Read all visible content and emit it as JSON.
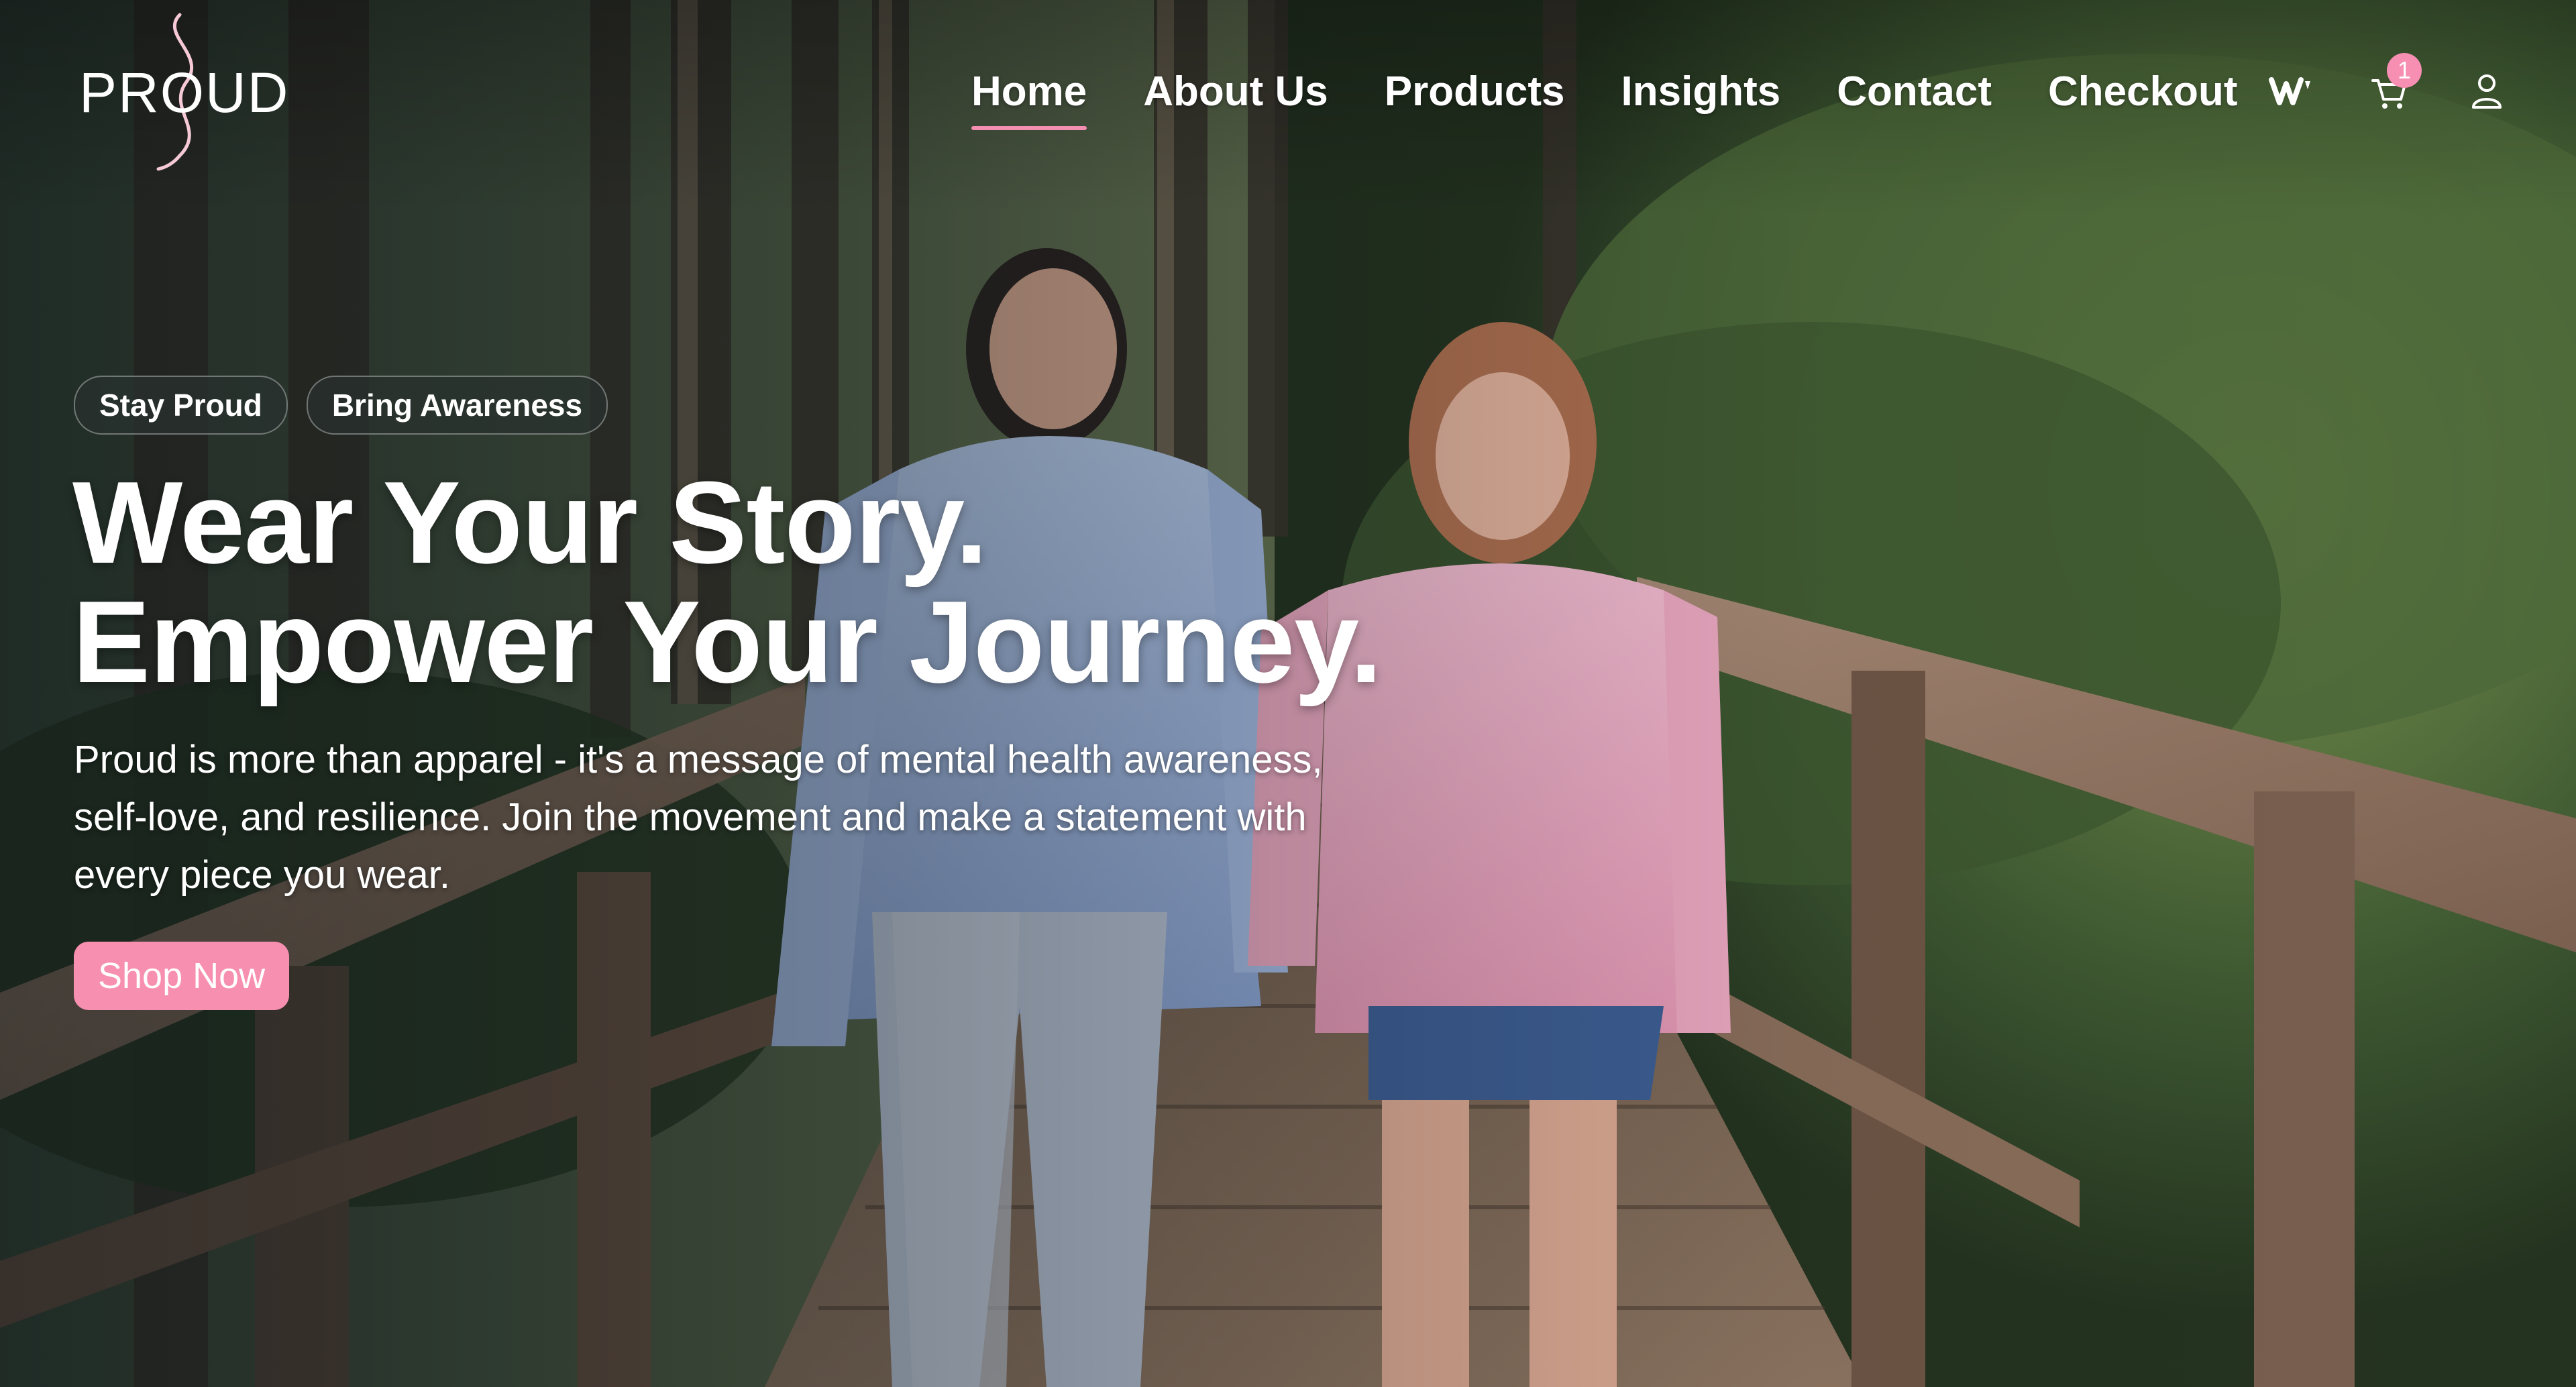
{
  "brand": {
    "logo_text": "PROUD"
  },
  "nav": {
    "links": [
      {
        "label": "Home",
        "active": true
      },
      {
        "label": "About Us",
        "active": false
      },
      {
        "label": "Products",
        "active": false
      },
      {
        "label": "Insights",
        "active": false
      },
      {
        "label": "Contact",
        "active": false
      },
      {
        "label": "Checkout",
        "active": false
      }
    ],
    "icons": [
      "wix-icon",
      "cart-icon",
      "user-icon"
    ],
    "cart_count": "1"
  },
  "hero": {
    "tags": [
      "Stay Proud",
      "Bring Awareness"
    ],
    "headline_line1": "Wear Your Story.",
    "headline_line2": "Empower Your Journey.",
    "description": "Proud is more than apparel - it's a message of mental health awareness, self-love, and resilience. Join the movement and make a statement with every piece you wear.",
    "cta_label": "Shop Now"
  },
  "colors": {
    "accent": "#f78fb1",
    "text": "#ffffff"
  }
}
